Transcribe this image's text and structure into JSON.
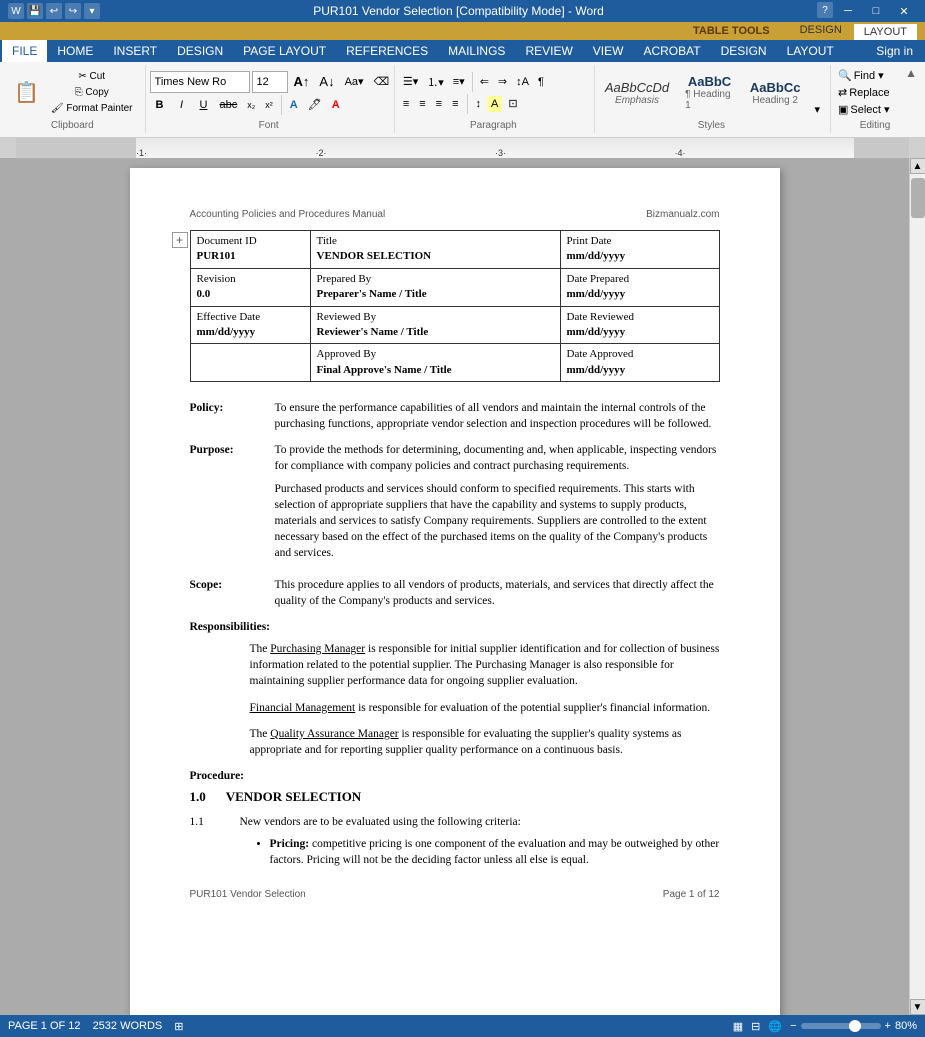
{
  "titleBar": {
    "title": "PUR101 Vendor Selection [Compatibility Mode] - Word",
    "appName": "Word",
    "tableTools": "TABLE TOOLS",
    "designTab": "DESIGN",
    "layoutTab": "LAYOUT",
    "helpIcon": "?",
    "minBtn": "─",
    "maxBtn": "□",
    "closeBtn": "✕",
    "titleIcons": [
      "💾",
      "↩",
      "↪"
    ]
  },
  "menuBar": {
    "items": [
      "FILE",
      "HOME",
      "INSERT",
      "DESIGN",
      "PAGE LAYOUT",
      "REFERENCES",
      "MAILINGS",
      "REVIEW",
      "VIEW",
      "ACROBAT",
      "DESIGN",
      "LAYOUT"
    ],
    "activeItem": "HOME",
    "signIn": "Sign in"
  },
  "ribbon": {
    "fontName": "Times New Ro",
    "fontSize": "12",
    "clipboardLabel": "Clipboard",
    "fontLabel": "Font",
    "paragraphLabel": "Paragraph",
    "stylesLabel": "Styles",
    "editingLabel": "Editing",
    "findLabel": "Find ▾",
    "replaceLabel": "Replace",
    "selectLabel": "Select ▾",
    "styles": [
      {
        "preview": "AaBbCcDd",
        "name": "Emphasis",
        "italic": true
      },
      {
        "preview": "AaBbC",
        "name": "¶ Heading 1",
        "bold": true
      },
      {
        "preview": "AaBbCc",
        "name": "Heading 2",
        "bold": true
      }
    ]
  },
  "docHeader": {
    "left": "Accounting Policies and Procedures Manual",
    "right": "Bizmanualz.com"
  },
  "infoTable": {
    "rows": [
      {
        "col1Label": "Document ID",
        "col1Value": "PUR101",
        "col2Label": "Title",
        "col2Value": "VENDOR SELECTION",
        "col3Label": "Print Date",
        "col3Value": "mm/dd/yyyy"
      },
      {
        "col1Label": "Revision",
        "col1Value": "0.0",
        "col2Label": "Prepared By",
        "col2Value": "Preparer's Name / Title",
        "col3Label": "Date Prepared",
        "col3Value": "mm/dd/yyyy"
      },
      {
        "col1Label": "Effective Date",
        "col1Value": "mm/dd/yyyy",
        "col2Label": "Reviewed By",
        "col2Value": "Reviewer's Name / Title",
        "col3Label": "Date Reviewed",
        "col3Value": "mm/dd/yyyy"
      },
      {
        "col1Label": "",
        "col1Value": "",
        "col2Label": "Approved By",
        "col2Value": "Final Approve's Name / Title",
        "col3Label": "Date Approved",
        "col3Value": "mm/dd/yyyy"
      }
    ]
  },
  "sections": {
    "policy": {
      "label": "Policy:",
      "text": "To ensure the performance capabilities of all vendors and maintain the internal controls of the purchasing functions, appropriate vendor selection and inspection procedures will be followed."
    },
    "purpose": {
      "label": "Purpose:",
      "text": "To provide the methods for determining, documenting and, when applicable, inspecting vendors for compliance with company policies and contract purchasing requirements.",
      "para2": "Purchased products and services should conform to specified requirements.  This starts with selection of appropriate suppliers that have the capability and systems to supply products, materials and services to satisfy Company requirements.  Suppliers are controlled to the extent necessary based on the effect of the purchased items on the quality of the Company's products and services."
    },
    "scope": {
      "label": "Scope:",
      "text": "This procedure applies to all vendors of products, materials, and services that directly affect the quality of the Company's products and services."
    },
    "responsibilities": {
      "label": "Responsibilities:",
      "para1prefix": "The ",
      "para1link": "Purchasing Manager",
      "para1suffix": " is responsible for initial supplier identification and for collection of business information related to the potential supplier. The Purchasing Manager is also responsible for maintaining supplier performance data for ongoing supplier evaluation.",
      "para2prefix": "",
      "para2link": "Financial Management",
      "para2suffix": " is responsible for evaluation of the potential supplier's financial information.",
      "para3prefix": "The ",
      "para3link": "Quality Assurance Manager",
      "para3suffix": " is responsible for evaluating the supplier's quality systems as appropriate and for reporting supplier quality performance on a continuous basis."
    },
    "procedure": {
      "label": "Procedure:",
      "section1number": "1.0",
      "section1title": "VENDOR SELECTION",
      "item11": "1.1",
      "item11text": "New vendors are to be evaluated using the following criteria:",
      "bullet1title": "Pricing:",
      "bullet1text": " competitive pricing is one component of the evaluation and may be outweighed by other factors.  Pricing will not be the deciding factor unless all else is equal."
    }
  },
  "footer": {
    "left": "PUR101 Vendor Selection",
    "right": "Page 1 of 12"
  },
  "statusBar": {
    "pageInfo": "PAGE 1 OF 12",
    "wordCount": "2532 WORDS",
    "trackChanges": "⊞",
    "zoom": "80%"
  }
}
